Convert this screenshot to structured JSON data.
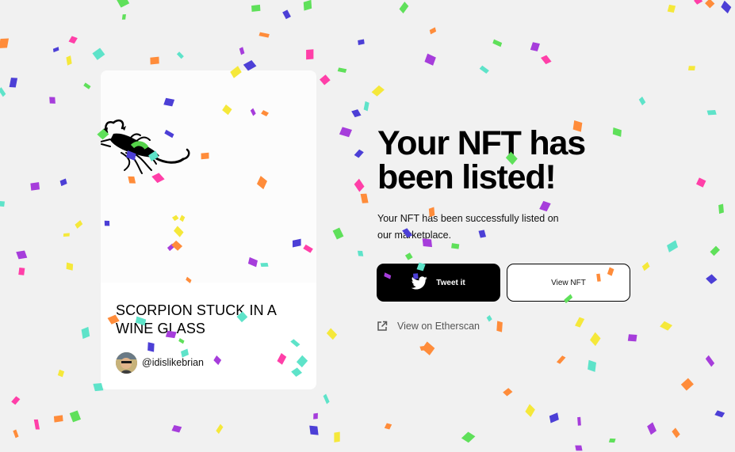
{
  "nft_card": {
    "title": "SCORPION STUCK IN A WINE GLASS",
    "creator": {
      "handle": "@idislikebrian"
    }
  },
  "hero": {
    "headline": "Your NFT has been listed!",
    "description": "Your NFT has been successfully listed on our marketplace."
  },
  "actions": {
    "tweet_label": "Tweet it",
    "view_nft_label": "View NFT",
    "etherscan_label": "View on Etherscan"
  },
  "icons": {
    "tweet": "twitter-icon",
    "etherscan": "external-link-icon"
  },
  "colors": {
    "background": "#f1f1f1",
    "card": "#ffffff",
    "primary_button": "#000000",
    "confetti": [
      "#4c3fd6",
      "#ff8c3a",
      "#a63ddb",
      "#5ee3c9",
      "#f5e83a",
      "#5fe05a",
      "#ff3fa8"
    ]
  }
}
